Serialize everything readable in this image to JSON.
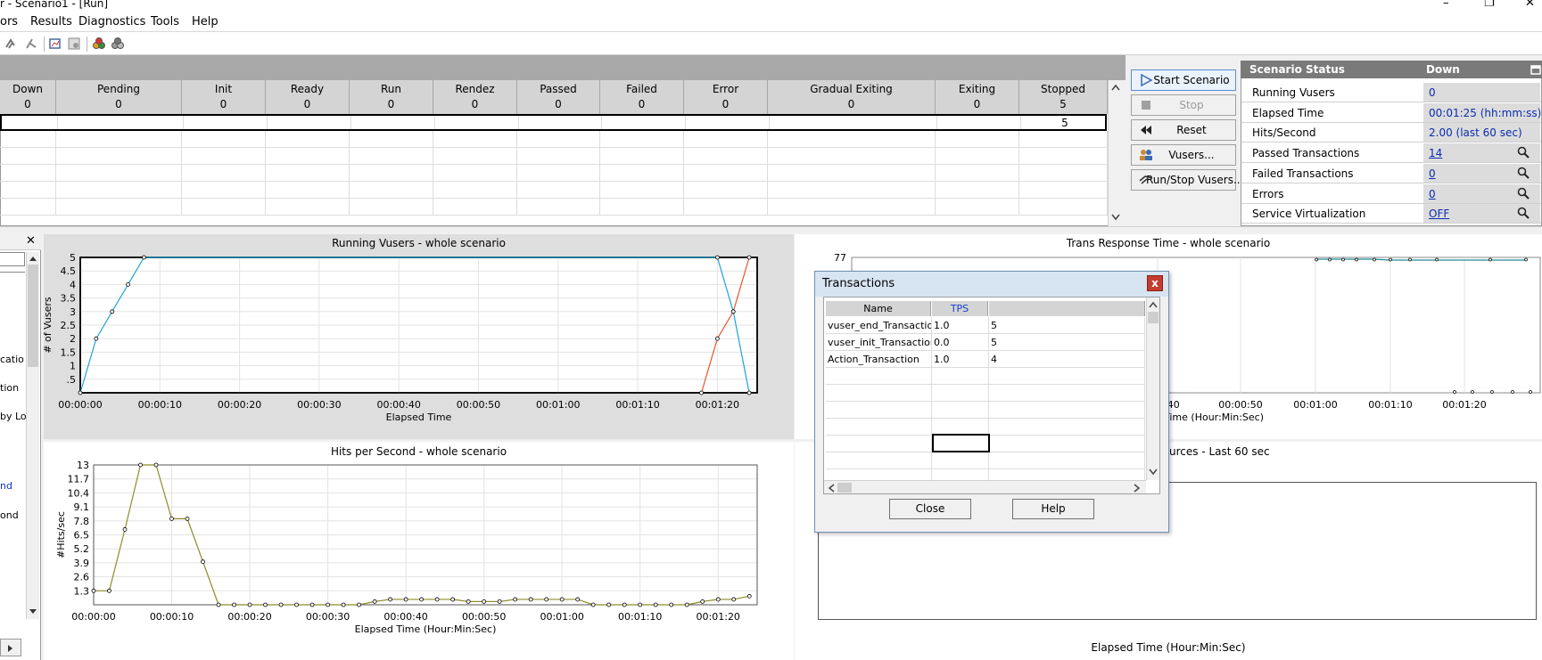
{
  "window": {
    "title": "r - Scenario1 - [Run]",
    "controls": {
      "minimize": "–",
      "restore": "❐",
      "close": "✕"
    }
  },
  "menu": [
    "ors",
    "Results",
    "Diagnostics",
    "Tools",
    "Help"
  ],
  "grid": {
    "columns": [
      {
        "label": "Down",
        "count": "0"
      },
      {
        "label": "Pending",
        "count": "0"
      },
      {
        "label": "Init",
        "count": "0"
      },
      {
        "label": "Ready",
        "count": "0"
      },
      {
        "label": "Run",
        "count": "0"
      },
      {
        "label": "Rendez",
        "count": "0"
      },
      {
        "label": "Passed",
        "count": "0"
      },
      {
        "label": "Failed",
        "count": "0"
      },
      {
        "label": "Error",
        "count": "0"
      },
      {
        "label": "Gradual Exiting",
        "count": "0"
      },
      {
        "label": "Exiting",
        "count": "0"
      },
      {
        "label": "Stopped",
        "count": "5"
      }
    ],
    "selected_row_stopped": "5"
  },
  "scenario_buttons": {
    "start": "Start Scenario",
    "stop": "Stop",
    "reset": "Reset",
    "vusers": "Vusers...",
    "run_stop": "Run/Stop Vusers..."
  },
  "status": {
    "title": "Scenario Status",
    "state": "Down",
    "rows": [
      {
        "label": "Running Vusers",
        "value": "0"
      },
      {
        "label": "Elapsed Time",
        "value": "00:01:25 (hh:mm:ss)"
      },
      {
        "label": "Hits/Second",
        "value": "2.00 (last 60 sec)"
      },
      {
        "label": "Passed Transactions",
        "value": "14"
      },
      {
        "label": "Failed Transactions",
        "value": "0"
      },
      {
        "label": "Errors",
        "value": "0"
      },
      {
        "label": "Service Virtualization",
        "value": "OFF"
      }
    ]
  },
  "left_pane": {
    "items": [
      "catio",
      "tion",
      "by Lo",
      "nd",
      "ond"
    ]
  },
  "graphs": {
    "running_vusers": {
      "title": "Running Vusers - whole scenario",
      "xlabel": "Elapsed Time",
      "ylabel": "# of Vusers",
      "yticks": [
        "5",
        "4.5",
        "4",
        "3.5",
        "3",
        "2.5",
        "2",
        "1.5",
        "1",
        ".5"
      ],
      "xticks": [
        "00:00:00",
        "00:00:10",
        "00:00:20",
        "00:00:30",
        "00:00:40",
        "00:00:50",
        "00:01:00",
        "00:01:10",
        "00:01:20"
      ]
    },
    "trans_response": {
      "title": "Trans Response Time - whole scenario",
      "ytop": "77",
      "xlabel": "Time (Hour:Min:Sec)",
      "xticks": [
        "00:00:40",
        "00:00:50",
        "00:01:00",
        "00:01:10",
        "00:01:20"
      ]
    },
    "hits": {
      "title": "Hits per Second - whole scenario",
      "xlabel": "Elapsed Time (Hour:Min:Sec)",
      "ylabel": "#Hits/sec",
      "yticks": [
        "13",
        "11.7",
        "10.4",
        "9.1",
        "7.8",
        "6.5",
        "5.2",
        "3.9",
        "2.6",
        "1.3"
      ],
      "xticks": [
        "00:00:00",
        "00:00:10",
        "00:00:20",
        "00:00:30",
        "00:00:40",
        "00:00:50",
        "00:01:00",
        "00:01:10",
        "00:01:20"
      ]
    },
    "resources": {
      "title": "urces - Last 60 sec",
      "xlabel": "Elapsed Time (Hour:Min:Sec)"
    }
  },
  "chart_data": [
    {
      "type": "line",
      "title": "Running Vusers - whole scenario",
      "xlabel": "Elapsed Time",
      "ylabel": "# of Vusers",
      "ylim": [
        0,
        5
      ],
      "xlim": [
        0,
        85
      ],
      "grid": true,
      "series": [
        {
          "color": "#1fa3d8",
          "x": [
            0,
            2,
            4,
            6,
            8,
            80,
            82,
            84
          ],
          "y": [
            0,
            2,
            3,
            4,
            5,
            5,
            3,
            0
          ]
        },
        {
          "color": "#e8542a",
          "x": [
            78,
            80,
            82,
            84
          ],
          "y": [
            0,
            2,
            3,
            5
          ]
        }
      ]
    },
    {
      "type": "line",
      "title": "Hits per Second - whole scenario",
      "xlabel": "Elapsed Time (Hour:Min:Sec)",
      "ylabel": "#Hits/sec",
      "ylim": [
        0,
        13
      ],
      "xlim": [
        0,
        85
      ],
      "grid": true,
      "series": [
        {
          "color": "#8c8c2a",
          "x": [
            0,
            2,
            4,
            6,
            8,
            10,
            12,
            14,
            16,
            18,
            20,
            22,
            24,
            26,
            28,
            30,
            32,
            34,
            36,
            38,
            40,
            42,
            44,
            46,
            48,
            50,
            52,
            54,
            56,
            58,
            60,
            62,
            64,
            66,
            68,
            70,
            72,
            74,
            76,
            78,
            80,
            82,
            84
          ],
          "y": [
            1.3,
            1.3,
            7,
            13,
            13,
            8,
            8,
            4,
            0,
            0,
            0,
            0,
            0,
            0,
            0,
            0,
            0,
            0,
            0.3,
            0.5,
            0.5,
            0.5,
            0.5,
            0.5,
            0.3,
            0.3,
            0.3,
            0.5,
            0.5,
            0.5,
            0.5,
            0.5,
            0,
            0,
            0,
            0,
            0,
            0,
            0,
            0.3,
            0.5,
            0.5,
            0.8
          ]
        }
      ]
    }
  ],
  "dialog": {
    "title": "Transactions",
    "close_x": "x",
    "headers": [
      "Name",
      "TPS",
      ""
    ],
    "rows": [
      {
        "name": "vuser_end_Transaction",
        "tps": "1.0",
        "count": "5"
      },
      {
        "name": "vuser_init_Transaction",
        "tps": "0.0",
        "count": "5"
      },
      {
        "name": "Action_Transaction",
        "tps": "1.0",
        "count": "4"
      }
    ],
    "close_button": "Close",
    "help_button": "Help"
  }
}
